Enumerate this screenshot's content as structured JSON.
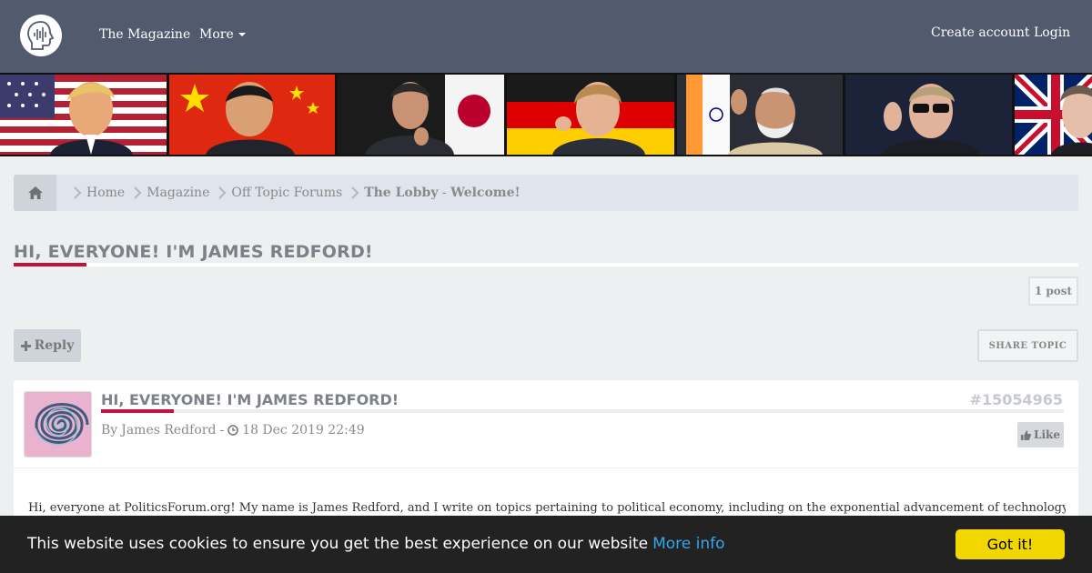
{
  "nav": {
    "magazine": "The Magazine",
    "more": "More",
    "create_account": "Create account",
    "login": "Login"
  },
  "breadcrumb": {
    "items": [
      "Home",
      "Magazine",
      "Off Topic Forums"
    ],
    "current_main": "The Lobby",
    "current_sep": " - ",
    "current_sub": "Welcome!"
  },
  "topic": {
    "title": "HI, EVERYONE! I'M JAMES REDFORD!",
    "post_count": "1 post",
    "reply_label": "Reply",
    "share_label": "SHARE TOPIC"
  },
  "post": {
    "title": "HI, EVERYONE! I'M JAMES REDFORD!",
    "id": "#15054965",
    "by": "By",
    "author": "James Redford",
    "dash": "-",
    "date": "18 Dec 2019 22:49",
    "like_label": "Like",
    "body": "Hi, everyone at PoliticsForum.org! My name is James Redford, and I write on topics pertaining to political economy, including on the exponential advancement of technology and the transformative"
  },
  "cookie": {
    "text": "This website uses cookies to ensure you get the best experience on our website",
    "link": "More info",
    "button": "Got it!"
  },
  "colors": {
    "navbar": "#525a6e",
    "accent": "#c0143c",
    "cookie_button": "#f1d600",
    "cookie_link": "#31a8f0"
  }
}
